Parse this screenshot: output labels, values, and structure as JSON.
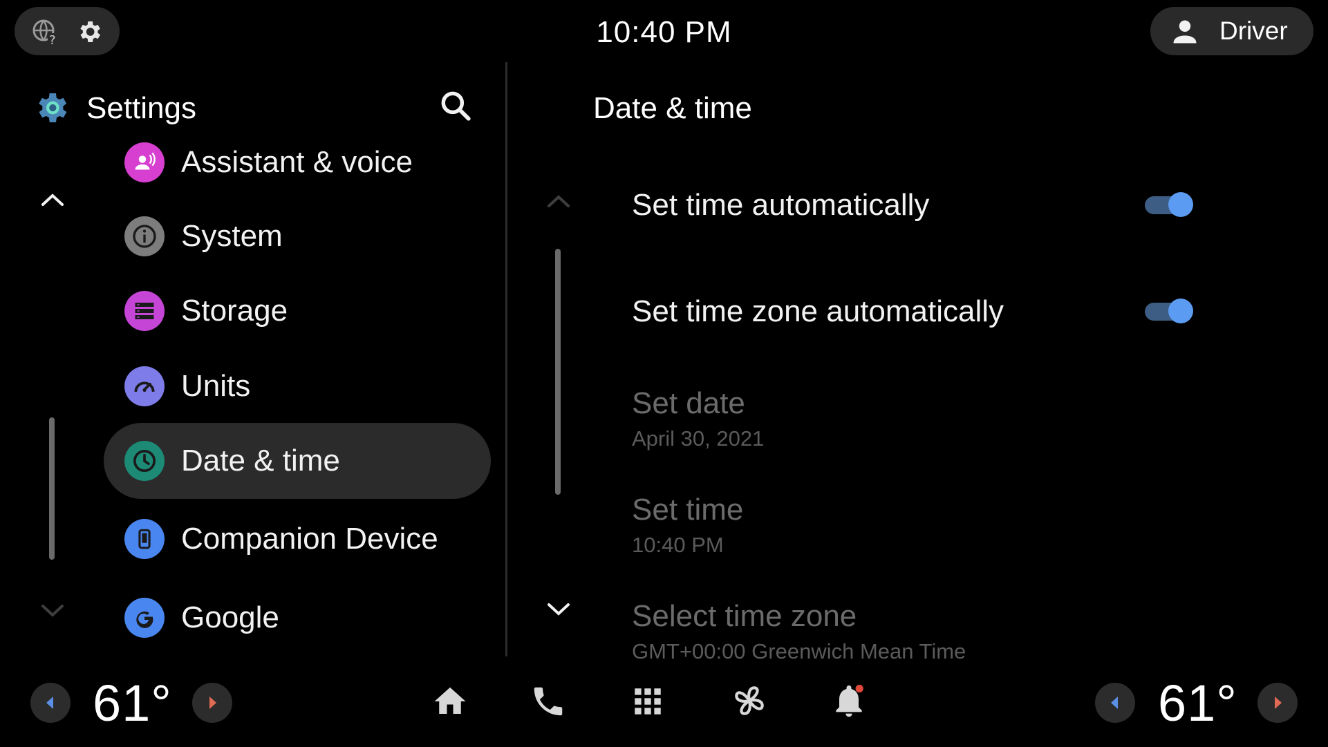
{
  "status_bar": {
    "time": "10:40 PM",
    "user_label": "Driver"
  },
  "settings_panel": {
    "title": "Settings",
    "items": [
      {
        "label": "Assistant & voice",
        "icon": "assistant-voice-icon",
        "color": "#d63fd0"
      },
      {
        "label": "System",
        "icon": "info-icon",
        "color": "#7d7d7d"
      },
      {
        "label": "Storage",
        "icon": "storage-icon",
        "color": "#c546d6"
      },
      {
        "label": "Units",
        "icon": "speedometer-icon",
        "color": "#7e7ce8"
      },
      {
        "label": "Date & time",
        "icon": "clock-icon",
        "color": "#1d8a76",
        "selected": true
      },
      {
        "label": "Companion Device",
        "icon": "phone-device-icon",
        "color": "#4a86f0"
      },
      {
        "label": "Google",
        "icon": "google-icon",
        "color": "#4a86f0"
      }
    ]
  },
  "detail_panel": {
    "title": "Date & time",
    "prefs": [
      {
        "title": "Set time automatically",
        "toggle": true
      },
      {
        "title": "Set time zone automatically",
        "toggle": true
      },
      {
        "title": "Set date",
        "summary": "April 30, 2021",
        "enabled": false
      },
      {
        "title": "Set time",
        "summary": "10:40 PM",
        "enabled": false
      },
      {
        "title": "Select time zone",
        "summary": "GMT+00:00 Greenwich Mean Time",
        "enabled": false
      }
    ]
  },
  "bottom_bar": {
    "left_temp": "61°",
    "right_temp": "61°",
    "nav_icons": [
      "home-icon",
      "phone-icon",
      "app-grid-icon",
      "fan-icon",
      "notification-bell-icon"
    ]
  },
  "colors": {
    "accent": "#5b9cf2",
    "background": "#000000",
    "selected_bg": "#2b2b2b"
  }
}
